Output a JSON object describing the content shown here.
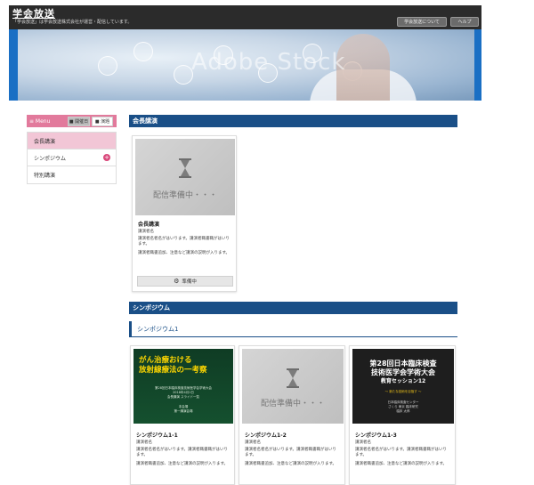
{
  "header": {
    "title": "学会放送",
    "subtitle": "「学会放送」は学会放送株式会社が運営・配信しています。",
    "about_label": "学会放送について",
    "help_label": "ヘルプ"
  },
  "banner": {
    "watermark": "Adobe Stock"
  },
  "sidebar": {
    "menu_label": "≡ Menu",
    "date_tab": "■ 開催日",
    "program_tab": "■ 演題",
    "items": [
      {
        "label": "会長講演",
        "active": true
      },
      {
        "label": "シンポジウム",
        "expand": "+"
      },
      {
        "label": "特別講演"
      }
    ]
  },
  "sections": [
    {
      "title": "会長講演",
      "cards": [
        {
          "thumb_text": "配信準備中・・・",
          "title": "会長講演",
          "speaker": "講演者名",
          "desc1": "講演者名者名がはいります。講演者職書職がはいります。",
          "desc2": "講演者職書追加、注意など講演の説明が入ります。",
          "button_label": "準備中"
        }
      ]
    },
    {
      "title": "シンポジウム",
      "subsection": "シンポジウム1",
      "cards": [
        {
          "slide_title_1": "がん治療おける",
          "slide_title_2": "放射線療法の一考察",
          "slide_lines": [
            "第28回日本臨床検査技術医学会学術大会",
            "2018年4月1日",
            "会長講演 スライド一覧"
          ],
          "slide_footer": [
            "本会場",
            "第一講演会場"
          ],
          "title": "シンポジウム1-1",
          "speaker": "講演者名",
          "desc1": "講演者名者名がはいります。講演者職書職がはいります。",
          "desc2": "講演者職書追加、注意など講演の説明が入ります。"
        },
        {
          "thumb_text": "配信準備中・・・",
          "title": "シンポジウム1-2",
          "speaker": "講演者名",
          "desc1": "講演者名者名がはいります。講演者職書職がはいります。",
          "desc2": "講演者職書追加、注意など講演の説明が入ります。"
        },
        {
          "slide_title_1": "第28回日本臨床検査",
          "slide_title_2": "技術医学会学術大会",
          "slide_title_3": "教育セッション12",
          "slide_subtitle": "〜 新たな技術を目指す 〜",
          "slide_lines": [
            "日本臨床検査センター",
            "さくら 東京 臨床研究",
            "臨床 太郎"
          ],
          "title": "シンポジウム1-3",
          "speaker": "講演者名",
          "desc1": "講演者名者名がはいります。講演者職書職がはいります。",
          "desc2": "講演者職書追加、注意など講演の説明が入ります。"
        }
      ]
    }
  ]
}
